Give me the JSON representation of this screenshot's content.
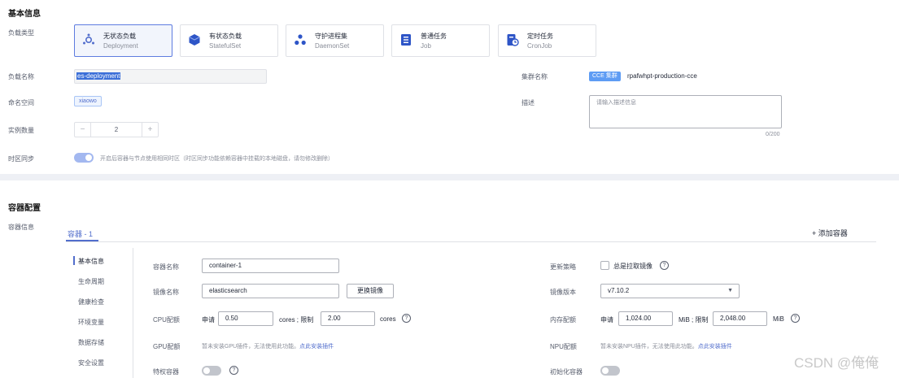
{
  "basic": {
    "section_title": "基本信息",
    "workload_type_label": "负载类型",
    "workload_types": [
      {
        "name": "无状态负载",
        "sub": "Deployment",
        "icon": "deployment-icon"
      },
      {
        "name": "有状态负载",
        "sub": "StatefulSet",
        "icon": "statefulset-icon"
      },
      {
        "name": "守护进程集",
        "sub": "DaemonSet",
        "icon": "daemonset-icon"
      },
      {
        "name": "普通任务",
        "sub": "Job",
        "icon": "job-icon"
      },
      {
        "name": "定时任务",
        "sub": "CronJob",
        "icon": "cronjob-icon"
      }
    ],
    "name_label": "负载名称",
    "name_value": "es-deployment",
    "cluster_label": "集群名称",
    "cluster_tag": "CCE 集群",
    "cluster_value": "rpafwhpt-production-cce",
    "namespace_label": "命名空间",
    "namespace_value": "xiaowo",
    "desc_label": "描述",
    "desc_placeholder": "请输入描述信息",
    "desc_counter": "0/200",
    "instances_label": "实例数量",
    "instances_minus": "−",
    "instances_value": "2",
    "instances_plus": "+",
    "timezone_label": "时区同步",
    "timezone_text": "开启后容器与节点使用相同时区（时区同步功能依赖容器中挂载的本地磁盘，请勿修改删除）"
  },
  "container": {
    "section_title": "容器配置",
    "info_label": "容器信息",
    "tab_label": "容器 - 1",
    "add_label": "+ 添加容器",
    "nav": [
      "基本信息",
      "生命周期",
      "健康检查",
      "环境变量",
      "数据存储",
      "安全设置"
    ],
    "name_label": "容器名称",
    "name_value": "container-1",
    "update_policy_label": "更新策略",
    "always_pull_label": "总是拉取镜像",
    "image_label": "镜像名称",
    "image_value": "elasticsearch",
    "change_image_btn": "更换镜像",
    "image_version_label": "镜像版本",
    "image_version_value": "v7.10.2",
    "cpu_label": "CPU配额",
    "cpu_request_label": "申请",
    "cpu_request": "0.50",
    "cpu_limit_label": "cores ; 限制",
    "cpu_limit": "2.00",
    "cpu_unit": "cores",
    "mem_label": "内存配额",
    "mem_request_label": "申请",
    "mem_request": "1,024.00",
    "mem_limit_label": "MiB ; 限制",
    "mem_limit": "2,048.00",
    "mem_unit": "MiB",
    "help_glyph": "?",
    "gpu_label": "GPU配额",
    "gpu_text": "暂未安装GPU插件，无法使用此功能。",
    "gpu_link": "点此安装插件",
    "npu_label": "NPU配额",
    "npu_text": "暂未安装NPU插件，无法使用此功能。",
    "npu_link": "点此安装插件",
    "privileged_label": "特权容器",
    "init_label": "初始化容器"
  },
  "watermark": "CSDN @俺俺",
  "colors": {
    "accent": "#526ecc",
    "selected_bg": "#f2f5fc",
    "divider": "#eef0f5"
  }
}
